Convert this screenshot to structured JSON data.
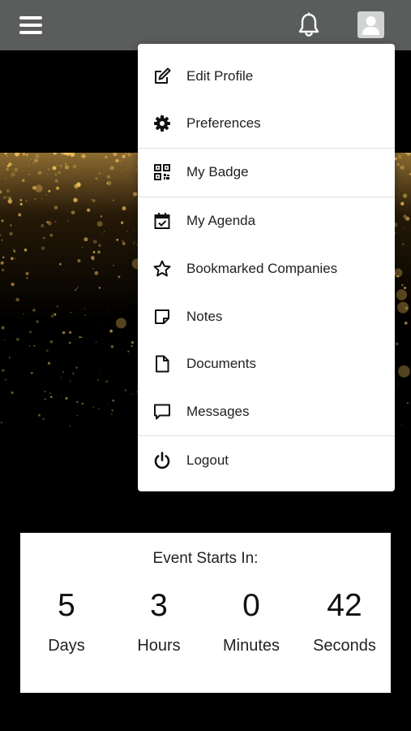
{
  "header": {
    "menu_icon": "hamburger-icon",
    "notifications_icon": "bell-icon",
    "profile_icon": "user-avatar-icon"
  },
  "menu": {
    "items": [
      {
        "label": "Edit Profile",
        "icon": "edit-icon"
      },
      {
        "label": "Preferences",
        "icon": "gear-icon"
      },
      {
        "label": "My Badge",
        "icon": "qr-code-icon"
      },
      {
        "label": "My Agenda",
        "icon": "calendar-check-icon"
      },
      {
        "label": "Bookmarked Companies",
        "icon": "star-icon"
      },
      {
        "label": "Notes",
        "icon": "note-icon"
      },
      {
        "label": "Documents",
        "icon": "document-icon"
      },
      {
        "label": "Messages",
        "icon": "message-icon"
      },
      {
        "label": "Logout",
        "icon": "power-icon"
      }
    ]
  },
  "countdown": {
    "title": "Event Starts In:",
    "units": [
      {
        "value": "5",
        "label": "Days"
      },
      {
        "value": "3",
        "label": "Hours"
      },
      {
        "value": "0",
        "label": "Minutes"
      },
      {
        "value": "42",
        "label": "Seconds"
      }
    ]
  },
  "colors": {
    "topbar": "#5b5d5d",
    "background": "#000000",
    "sparkle": "#f2c15a",
    "menu_bg": "#ffffff"
  }
}
